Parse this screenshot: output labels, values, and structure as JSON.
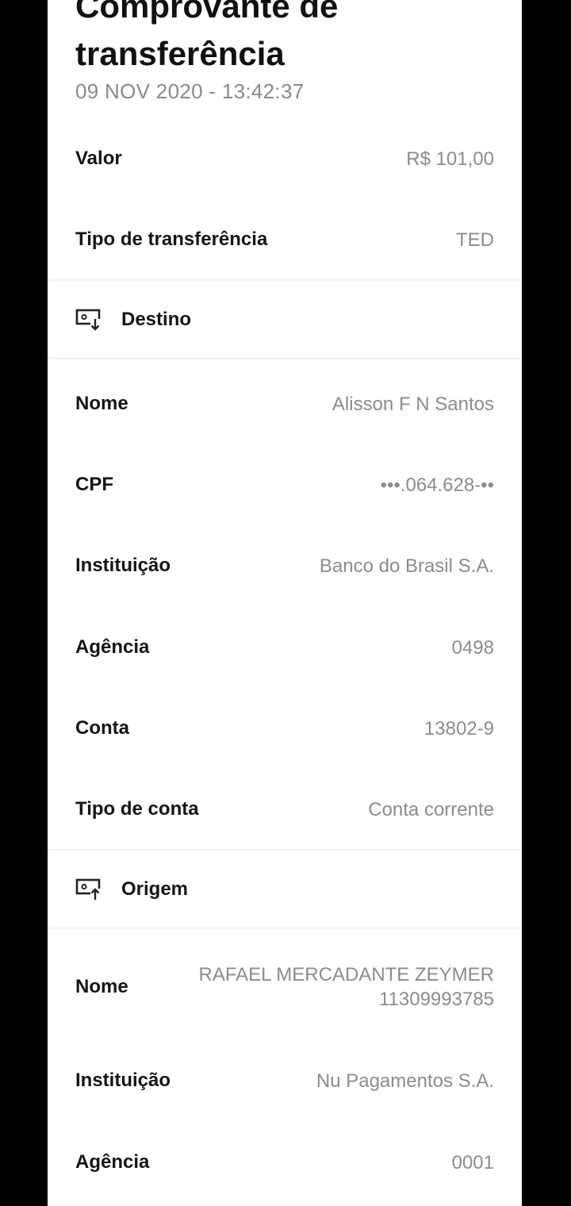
{
  "receipt": {
    "title": "Comprovante de\ntransferência",
    "datetime": "09 NOV 2020 - 13:42:37",
    "valor": {
      "label": "Valor",
      "value": "R$ 101,00"
    },
    "tipo_transferencia": {
      "label": "Tipo de transferência",
      "value": "TED"
    }
  },
  "destino": {
    "section_title": "Destino",
    "icon": "receive-money-icon",
    "nome": {
      "label": "Nome",
      "value": "Alisson F N Santos"
    },
    "cpf": {
      "label": "CPF",
      "value": "•••.064.628-••"
    },
    "instituicao": {
      "label": "Instituição",
      "value": "Banco do Brasil S.A."
    },
    "agencia": {
      "label": "Agência",
      "value": "0498"
    },
    "conta": {
      "label": "Conta",
      "value": "13802-9"
    },
    "tipo_conta": {
      "label": "Tipo de conta",
      "value": "Conta corrente"
    }
  },
  "origem": {
    "section_title": "Origem",
    "icon": "send-money-icon",
    "nome": {
      "label": "Nome",
      "value_line1": "RAFAEL MERCADANTE ZEYMER",
      "value_line2": "11309993785"
    },
    "instituicao": {
      "label": "Instituição",
      "value": "Nu Pagamentos S.A."
    },
    "agencia": {
      "label": "Agência",
      "value": "0001"
    }
  },
  "colors": {
    "background": "#000000",
    "sheet": "#ffffff",
    "label": "#151515",
    "value": "#8c8c8c",
    "divider": "#f1f1f1"
  }
}
